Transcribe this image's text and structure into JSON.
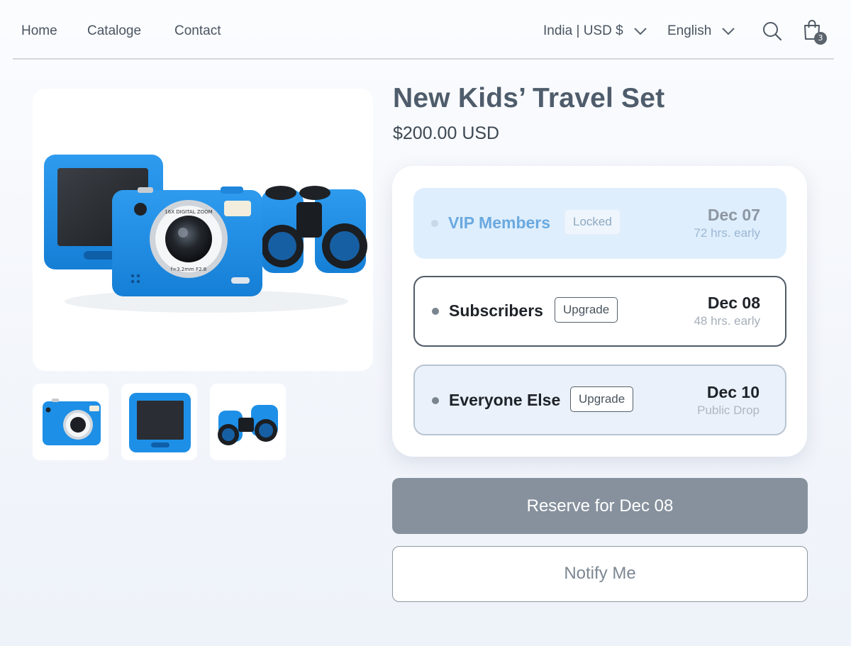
{
  "nav": {
    "links": [
      "Home",
      "Cataloge",
      "Contact"
    ],
    "region": "India | USD $",
    "language": "English",
    "cart_count": "3"
  },
  "product": {
    "title": "New Kids’ Travel Set",
    "price": "$200.00 USD",
    "lens_text_top": "16X DIGITAL ZOOM",
    "lens_text_bottom": "f=3.2mm  F2.8"
  },
  "tiers": [
    {
      "name": "VIP Members",
      "tag": "Locked",
      "date": "Dec 07",
      "note": "72 hrs. early"
    },
    {
      "name": "Subscribers",
      "tag": "Upgrade",
      "date": "Dec 08",
      "note": "48 hrs. early"
    },
    {
      "name": "Everyone Else",
      "tag": "Upgrade",
      "date": "Dec 10",
      "note": "Public Drop"
    }
  ],
  "actions": {
    "reserve_label": "Reserve for Dec 08",
    "notify_label": "Notify Me"
  },
  "colors": {
    "accent_blue": "#1e8fe6",
    "reserve_button": "#86919d",
    "vip_tier_bg": "#deeefd"
  }
}
